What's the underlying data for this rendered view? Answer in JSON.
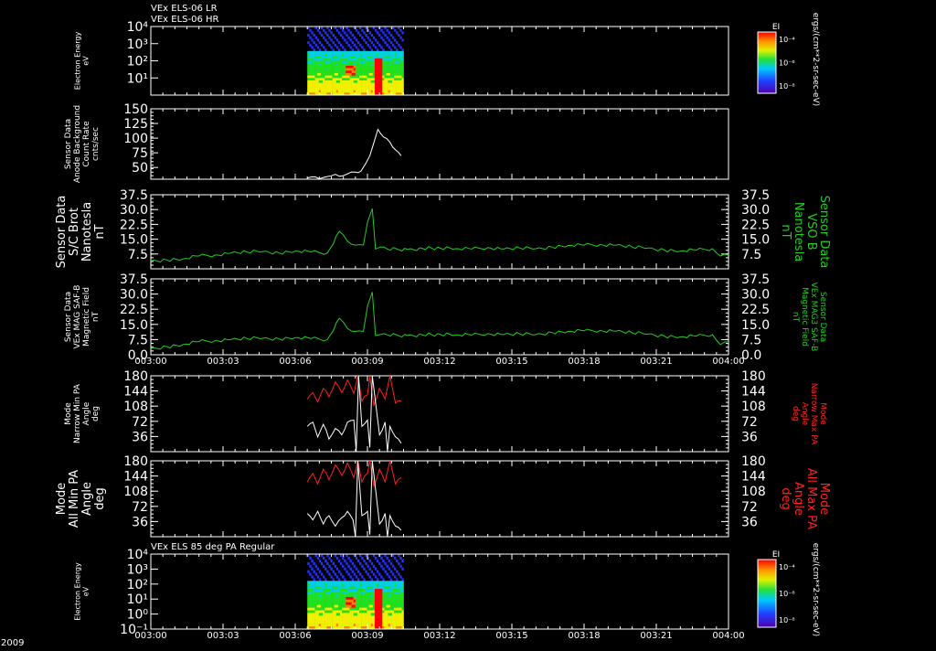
{
  "titles": {
    "top_line1": "VEx ELS-06 LR",
    "top_line2": "VEx ELS-06 HR",
    "bottom": "VEx ELS 85 deg PA Regular"
  },
  "x_axis": {
    "year_label": "2009",
    "start_min": 0,
    "end_min": 60,
    "ticks": [
      {
        "min": 0,
        "label": "003:00"
      },
      {
        "min": 9,
        "label": "003:03"
      },
      {
        "min": 18,
        "label": "003:06"
      },
      {
        "min": 27,
        "label": "003:09"
      },
      {
        "min": 36,
        "label": "003:12"
      },
      {
        "min": 45,
        "label": "003:15"
      },
      {
        "min": 54,
        "label": "003:18"
      },
      {
        "min": 63,
        "label": "003:21"
      },
      {
        "min": 72,
        "label": "004:00"
      }
    ]
  },
  "colorbars": {
    "top": {
      "label": "EI",
      "unit": "ergs/(cm**2-sr-sec-eV)",
      "ticks": [
        "10⁻⁴",
        "10⁻⁶",
        "10⁻⁸"
      ]
    },
    "bottom": {
      "label": "EI",
      "unit": "ergs/(cm**2-sr-sec-eV)",
      "ticks": [
        "10⁻⁴",
        "10⁻⁶",
        "10⁻⁸"
      ]
    }
  },
  "colors": {
    "magnetic": "#22cc22",
    "max_pa": "#ff2020",
    "min_pa": "#ffffff",
    "counts": "#ffffff"
  },
  "chart_data": [
    {
      "type": "heatmap",
      "panel": "electron_energy_top",
      "ylabel": [
        "Electron Energy",
        "eV"
      ],
      "ylim_log": [
        0,
        4
      ],
      "yticks": [
        "10⁴",
        "10³",
        "10²",
        "10¹"
      ],
      "data_start_min": 19.5,
      "data_end_min": 31.5
    },
    {
      "type": "line",
      "panel": "sensor_counts",
      "ylabel": [
        "Sensor Data",
        "Anode Background",
        "Count Rate",
        "cnts/sec"
      ],
      "ylim": [
        30,
        150
      ],
      "yticks": [
        150,
        125,
        100,
        75,
        50
      ],
      "series": [
        {
          "x": [
            19.5,
            20.5,
            21.5,
            22.5,
            23.5,
            24.5,
            25.5,
            26.2,
            26.8,
            27.3,
            27.8,
            28.3,
            29,
            29.8,
            30.5,
            31.2
          ],
          "y": [
            32,
            34,
            33,
            36,
            35,
            39,
            42,
            44,
            57,
            70,
            92,
            115,
            102,
            93,
            80,
            70
          ]
        }
      ]
    },
    {
      "type": "line",
      "panel": "scbrot",
      "ylabel": [
        "Sensor Data",
        "S/C Brot",
        "Nanotesla",
        "nT"
      ],
      "right_label": [
        "Sensor Data",
        "VSO B",
        "Nanotesla",
        "nT"
      ],
      "ylim": [
        0,
        37.5
      ],
      "yticks": [
        37.5,
        30.0,
        22.5,
        15.0,
        7.5
      ],
      "series": [
        {
          "x": [
            0,
            2,
            4,
            6,
            8,
            10,
            12,
            14,
            16,
            18,
            20,
            22,
            23.5,
            24.5,
            25.5,
            26.5,
            27.0,
            27.6,
            28.0,
            28.6,
            29.5,
            32,
            35,
            38,
            40,
            42,
            44,
            46,
            48,
            50,
            52,
            54,
            56,
            58,
            60,
            62,
            64,
            66,
            68,
            70,
            71,
            72
          ],
          "y": [
            4,
            4.5,
            5,
            6.5,
            7,
            8,
            8.5,
            8.8,
            8,
            9,
            8.5,
            8,
            19,
            14,
            12,
            12,
            23.5,
            30.5,
            10,
            11,
            10,
            9.8,
            10.5,
            10.2,
            10,
            10.8,
            10,
            10.5,
            10.2,
            11,
            11.8,
            12,
            12.3,
            12,
            11,
            10.5,
            9.5,
            9,
            9.5,
            10.2,
            6.5,
            7
          ]
        }
      ]
    },
    {
      "type": "line",
      "panel": "vexmag",
      "ylabel": [
        "Sensor Data",
        "VEx MAG SAF-B",
        "Magnetic Field",
        "nT"
      ],
      "right_label": [
        "Sensor Data",
        "VEx MAG3 SAF-B",
        "Magnetic Field",
        "nT"
      ],
      "ylim": [
        0,
        37.5
      ],
      "yticks": [
        37.5,
        30.0,
        22.5,
        15.0,
        7.5,
        0.0
      ],
      "series": [
        {
          "x": [
            0,
            2,
            4,
            6,
            8,
            10,
            12,
            14,
            16,
            18,
            20,
            22,
            23.5,
            24.5,
            25.5,
            26.5,
            27.0,
            27.6,
            28.0,
            28.6,
            29.5,
            32,
            35,
            38,
            40,
            42,
            44,
            46,
            48,
            50,
            52,
            54,
            56,
            58,
            60,
            62,
            64,
            66,
            68,
            70,
            71,
            72
          ],
          "y": [
            3,
            4,
            5,
            6.5,
            7,
            7.5,
            8,
            8.2,
            7.8,
            8.5,
            8,
            7.5,
            18,
            13,
            11.5,
            11.5,
            24,
            31,
            9.5,
            10,
            9.8,
            9.5,
            10,
            9.8,
            9.7,
            10.5,
            10,
            10.3,
            10,
            11,
            11.5,
            11.8,
            12,
            11.7,
            10.8,
            10.3,
            9.2,
            8.8,
            9.2,
            10,
            5,
            6.5
          ]
        }
      ]
    },
    {
      "type": "line",
      "panel": "narrow_pa",
      "ylabel": [
        "Mode",
        "Narrow Min PA",
        "Angle",
        "deg"
      ],
      "right_label": [
        "Mode",
        "Narrow Max PA",
        "Angle",
        "deg"
      ],
      "ylim": [
        0,
        180
      ],
      "yticks": [
        180,
        144,
        108,
        72,
        36
      ],
      "series": [
        {
          "name": "max",
          "x": [
            19.5,
            20.2,
            20.8,
            21.5,
            22.2,
            23,
            23.8,
            24.5,
            25.3,
            25.8,
            26.3,
            27,
            27.3,
            27.8,
            28.5,
            29.2,
            29.8,
            30.5,
            31.2
          ],
          "y": [
            125,
            140,
            118,
            150,
            130,
            165,
            140,
            170,
            138,
            180,
            120,
            135,
            178,
            110,
            150,
            125,
            180,
            115,
            120
          ]
        },
        {
          "name": "min",
          "x": [
            19.5,
            20.2,
            20.8,
            21.5,
            22.2,
            23,
            23.8,
            24.5,
            25.3,
            25.6,
            25.9,
            26.3,
            27,
            27.3,
            27.6,
            28.5,
            29.2,
            29.5,
            29.8,
            30.5,
            31.2
          ],
          "y": [
            60,
            70,
            35,
            65,
            30,
            55,
            40,
            70,
            75,
            0,
            180,
            60,
            75,
            10,
            180,
            40,
            70,
            0,
            60,
            35,
            20
          ]
        }
      ]
    },
    {
      "type": "line",
      "panel": "all_pa",
      "ylabel": [
        "Mode",
        "All Min PA",
        "Angle",
        "deg"
      ],
      "right_label": [
        "Mode",
        "All Max PA",
        "Angle",
        "deg"
      ],
      "ylim": [
        0,
        180
      ],
      "yticks": [
        180,
        144,
        108,
        72,
        36
      ],
      "series": [
        {
          "name": "max",
          "x": [
            19.5,
            20.2,
            20.8,
            21.5,
            22.2,
            23,
            23.8,
            24.5,
            25.3,
            25.8,
            26.3,
            27,
            27.3,
            27.8,
            28.5,
            29.2,
            29.8,
            30.5,
            31.2
          ],
          "y": [
            130,
            150,
            125,
            160,
            135,
            170,
            145,
            175,
            140,
            180,
            130,
            150,
            180,
            120,
            160,
            130,
            180,
            125,
            140
          ]
        },
        {
          "name": "min",
          "x": [
            19.5,
            20.2,
            20.8,
            21.5,
            22.2,
            23,
            23.8,
            24.5,
            25.2,
            25.5,
            25.8,
            26.3,
            27,
            27.3,
            27.6,
            28.5,
            29.2,
            29.5,
            29.8,
            30.5,
            31.2
          ],
          "y": [
            55,
            40,
            60,
            30,
            50,
            25,
            45,
            60,
            40,
            0,
            180,
            50,
            60,
            5,
            180,
            30,
            55,
            0,
            50,
            25,
            15
          ]
        }
      ]
    },
    {
      "type": "heatmap",
      "panel": "electron_energy_bottom",
      "ylabel": [
        "Electron Energy",
        "eV"
      ],
      "ylim_log": [
        -1,
        4
      ],
      "yticks": [
        "10⁴",
        "10³",
        "10²",
        "10¹",
        "10⁰",
        "10⁻¹"
      ],
      "data_start_min": 19.5,
      "data_end_min": 31.5
    }
  ]
}
